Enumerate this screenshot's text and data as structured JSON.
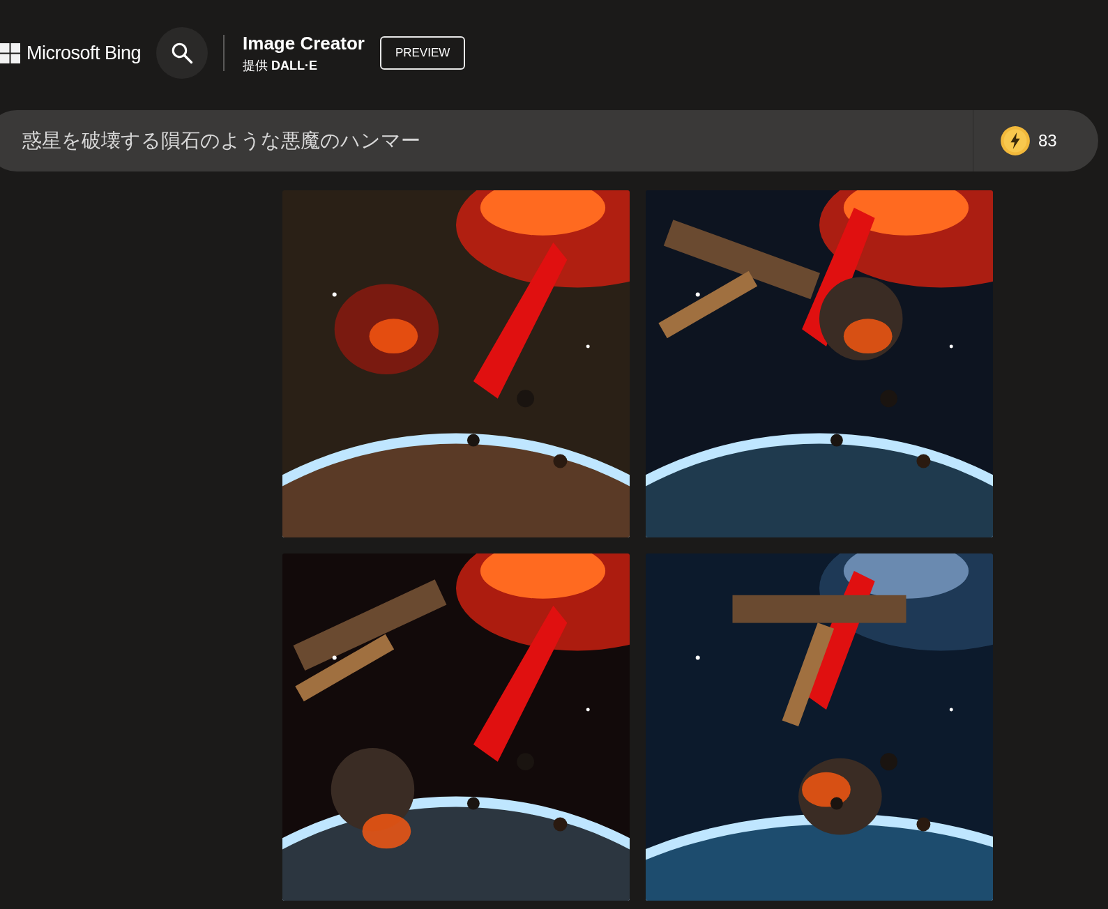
{
  "header": {
    "brand": "Microsoft Bing",
    "title": "Image Creator",
    "subtitle_prefix": "提供",
    "subtitle_brand": "DALL·E",
    "badge": "PREVIEW"
  },
  "prompt": {
    "value": "惑星を破壊する隕石のような悪魔のハンマー",
    "coins": "83"
  }
}
